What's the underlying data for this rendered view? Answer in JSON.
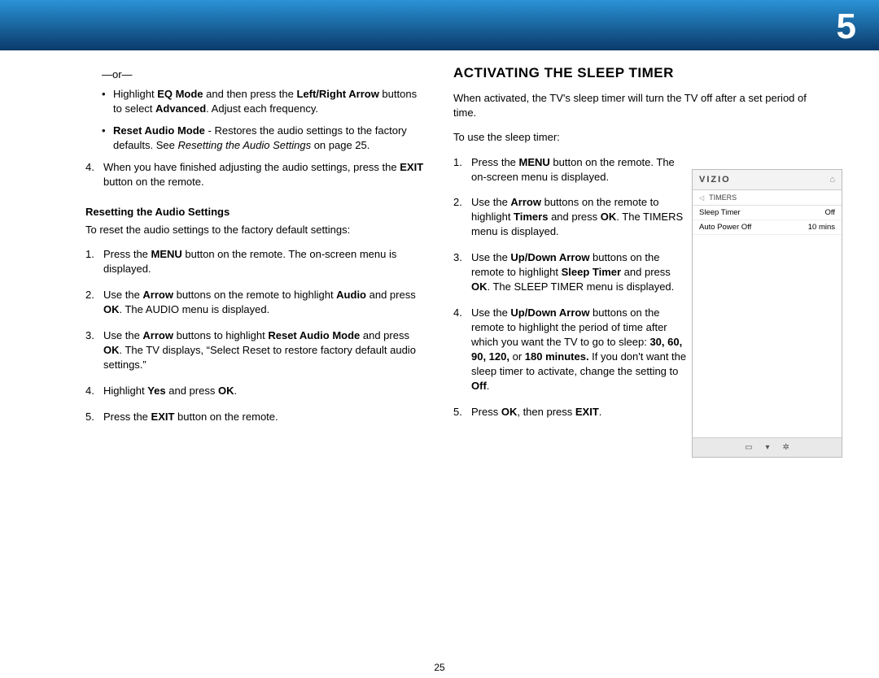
{
  "chapter_number": "5",
  "page_number": "25",
  "left_column": {
    "or_separator": "—or—",
    "bullets": [
      {
        "html": "Highlight <b>EQ Mode</b> and then press the <b>Left/Right Arrow</b> buttons to select <b>Advanced</b>. Adjust each frequency."
      },
      {
        "html": "<b>Reset Audio Mode</b> - Restores the audio settings to the factory defaults. See <i>Resetting the Audio Settings</i> on page 25."
      }
    ],
    "continued_step": {
      "num": "4.",
      "html": "When you have finished adjusting the audio settings, press the <b>EXIT</b> button on the remote."
    },
    "reset_heading": "Resetting the Audio Settings",
    "reset_intro": "To reset the audio settings to the factory default settings:",
    "reset_steps": [
      {
        "num": "1.",
        "html": "Press the <b>MENU</b> button on the remote. The on-screen menu is displayed."
      },
      {
        "num": "2.",
        "html": "Use the <b>Arrow</b> buttons on the remote to highlight <b>Audio</b> and press <b>OK</b>. The AUDIO menu is displayed."
      },
      {
        "num": "3.",
        "html": "Use the <b>Arrow</b> buttons to highlight <b>Reset Audio Mode</b> and press <b>OK</b>. The TV displays, “Select Reset to restore factory default audio settings.”"
      },
      {
        "num": "4.",
        "html": "Highlight <b>Yes</b> and press <b>OK</b>."
      },
      {
        "num": "5.",
        "html": "Press the <b>EXIT</b> button on the remote."
      }
    ]
  },
  "right_column": {
    "title": "ACTIVATING THE SLEEP TIMER",
    "intro1": "When activated, the TV's sleep timer will turn the TV off after a set period of time.",
    "intro2": "To use the sleep timer:",
    "steps": [
      {
        "num": "1.",
        "html": "Press the <b>MENU</b> button on the remote. The on-screen menu is displayed."
      },
      {
        "num": "2.",
        "html": "Use the <b>Arrow</b> buttons on the remote to highlight <b>Timers</b> and press <b>OK</b>. The TIMERS menu is displayed."
      },
      {
        "num": "3.",
        "html": "Use the <b>Up/Down Arrow</b> buttons on the remote to highlight <b>Sleep Timer</b> and press <b>OK</b>. The SLEEP TIMER menu is displayed."
      },
      {
        "num": "4.",
        "html": "Use the <b>Up/Down Arrow</b> buttons on the remote to highlight the period of time after which you want the TV to go to sleep: <b>30, 60, 90, 120,</b> or <b>180 minutes.</b> If you don't want the sleep timer to activate, change the setting to <b>Off</b>."
      },
      {
        "num": "5.",
        "html": "Press <b>OK</b>, then press <b>EXIT</b>."
      }
    ]
  },
  "tv_menu": {
    "logo": "VIZIO",
    "breadcrumb": "TIMERS",
    "rows": [
      {
        "label": "Sleep Timer",
        "value": "Off"
      },
      {
        "label": "Auto Power Off",
        "value": "10 mins"
      }
    ]
  }
}
